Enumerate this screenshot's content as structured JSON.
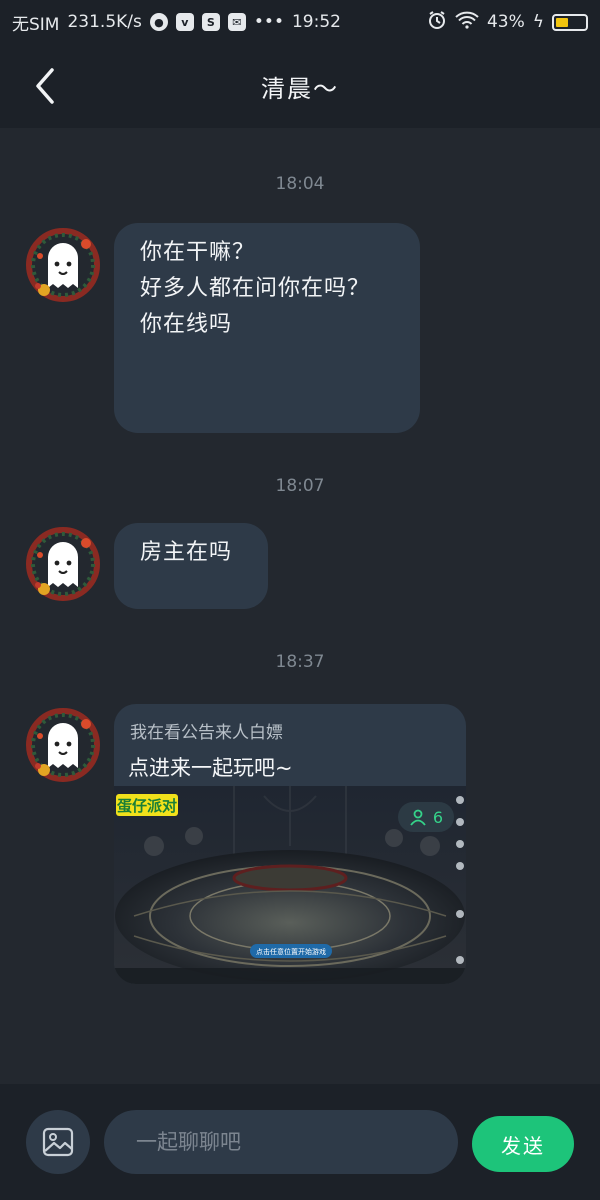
{
  "status_bar": {
    "carrier": "无SIM",
    "speed": "231.5K/s",
    "app_icons": [
      "planet-icon",
      "vivo-icon",
      "s-app-icon",
      "mail-icon"
    ],
    "more": "•••",
    "time": "19:52",
    "battery_percent": "43%",
    "battery_level": 0.43
  },
  "header": {
    "title": "清晨～"
  },
  "messages": [
    {
      "time": "18:04",
      "lines": [
        "你在干嘛？",
        "好多人都在问你在吗？",
        "你在线吗"
      ]
    },
    {
      "time": "18:07",
      "lines": [
        "房主在吗"
      ]
    },
    {
      "time": "18:37",
      "card": {
        "subtitle": "我在看公告来人白嫖",
        "title": "点进来一起玩吧~",
        "player_count": "6",
        "game_name": "蛋仔派对",
        "start_hint": "点击任意位置开始游戏"
      }
    }
  ],
  "input": {
    "placeholder": "一起聊聊吧"
  },
  "send_label": "发送",
  "colors": {
    "background": "#23282f",
    "bar": "#1c2128",
    "bubble": "#2e3a48",
    "accent": "#1dc47a"
  }
}
